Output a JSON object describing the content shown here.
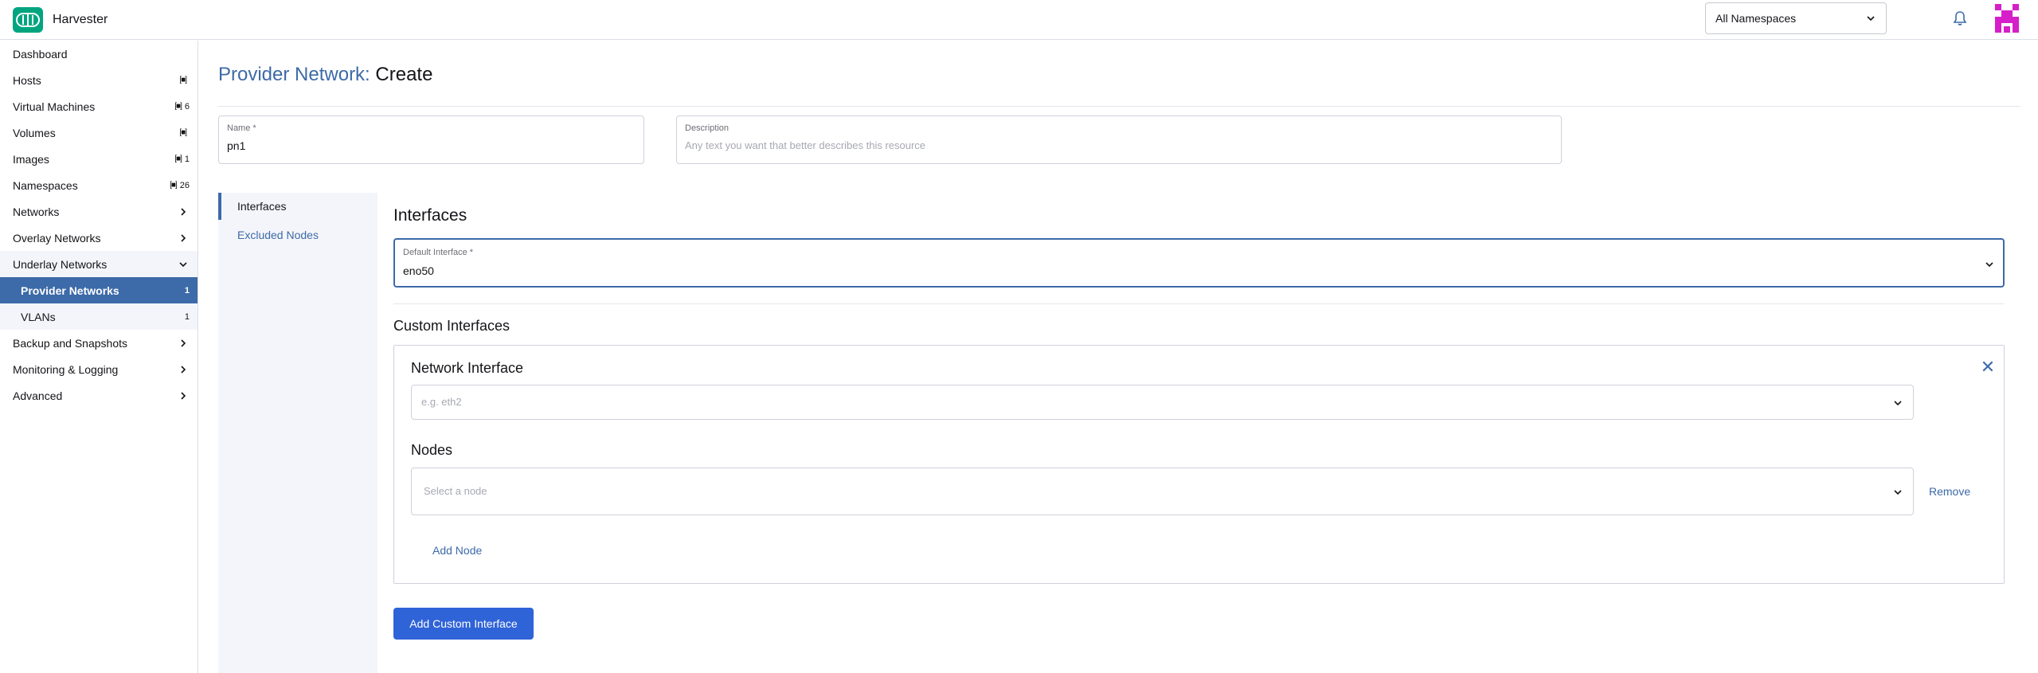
{
  "app": {
    "name": "Harvester",
    "logo_icon": "harvester-logo-icon",
    "brand_color": "#00a580"
  },
  "header": {
    "namespace_select": "All Namespaces"
  },
  "sidebar": {
    "items": [
      {
        "label": "Dashboard"
      },
      {
        "label": "Hosts",
        "count": ""
      },
      {
        "label": "Virtual Machines",
        "count": "6"
      },
      {
        "label": "Volumes",
        "count": ""
      },
      {
        "label": "Images",
        "count": "1"
      },
      {
        "label": "Namespaces",
        "count": "26"
      },
      {
        "label": "Networks"
      },
      {
        "label": "Overlay Networks"
      },
      {
        "label": "Underlay Networks"
      },
      {
        "label": "Provider Networks",
        "count": "1"
      },
      {
        "label": "VLANs",
        "count": "1"
      },
      {
        "label": "Backup and Snapshots"
      },
      {
        "label": "Monitoring & Logging"
      },
      {
        "label": "Advanced"
      }
    ]
  },
  "page": {
    "crumb": "Provider Network:",
    "action": "Create"
  },
  "form": {
    "name": {
      "label": "Name *",
      "value": "pn1"
    },
    "description": {
      "label": "Description",
      "placeholder": "Any text you want that better describes this resource"
    }
  },
  "tabs": [
    {
      "label": "Interfaces"
    },
    {
      "label": "Excluded Nodes"
    }
  ],
  "interfaces": {
    "title": "Interfaces",
    "default_interface": {
      "label": "Default Interface *",
      "value": "eno50"
    },
    "custom_title": "Custom Interfaces",
    "card": {
      "network_interface_title": "Network Interface",
      "network_interface_placeholder": "e.g. eth2",
      "nodes_title": "Nodes",
      "node_placeholder": "Select a node",
      "remove_label": "Remove",
      "add_node_label": "Add Node"
    },
    "add_custom_label": "Add Custom Interface"
  },
  "colors": {
    "accent": "#3d6aa8",
    "primary_button": "#2f63d8",
    "active_nav": "#3d6aa8"
  }
}
